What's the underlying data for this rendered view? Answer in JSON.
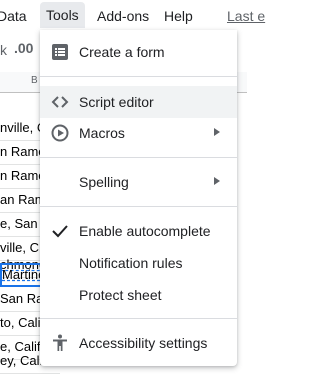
{
  "menubar": {
    "items": [
      "Data",
      "Tools",
      "Add-ons",
      "Help"
    ],
    "last_edit": "Last e"
  },
  "toolbar": {
    "decimal_label": ".00",
    "k_label": "k"
  },
  "sheet": {
    "column_header": "B",
    "cells": [
      "nville, C",
      "n Ramo",
      "n Ramo",
      "an Ram",
      "e, San R",
      "ville, C",
      "chmonc",
      "Martine",
      "San Ra",
      "to, Cali",
      "e, Califo",
      "ey, Cali"
    ]
  },
  "tools_menu": {
    "items": [
      {
        "label": "Create a form",
        "icon": "form-icon"
      },
      {
        "label": "Script editor",
        "icon": "code-icon"
      },
      {
        "label": "Macros",
        "icon": "play-circle-icon"
      },
      {
        "label": "Spelling"
      },
      {
        "label": "Enable autocomplete",
        "icon": "check-icon"
      },
      {
        "label": "Notification rules"
      },
      {
        "label": "Protect sheet"
      },
      {
        "label": "Accessibility settings",
        "icon": "accessibility-icon"
      }
    ]
  }
}
